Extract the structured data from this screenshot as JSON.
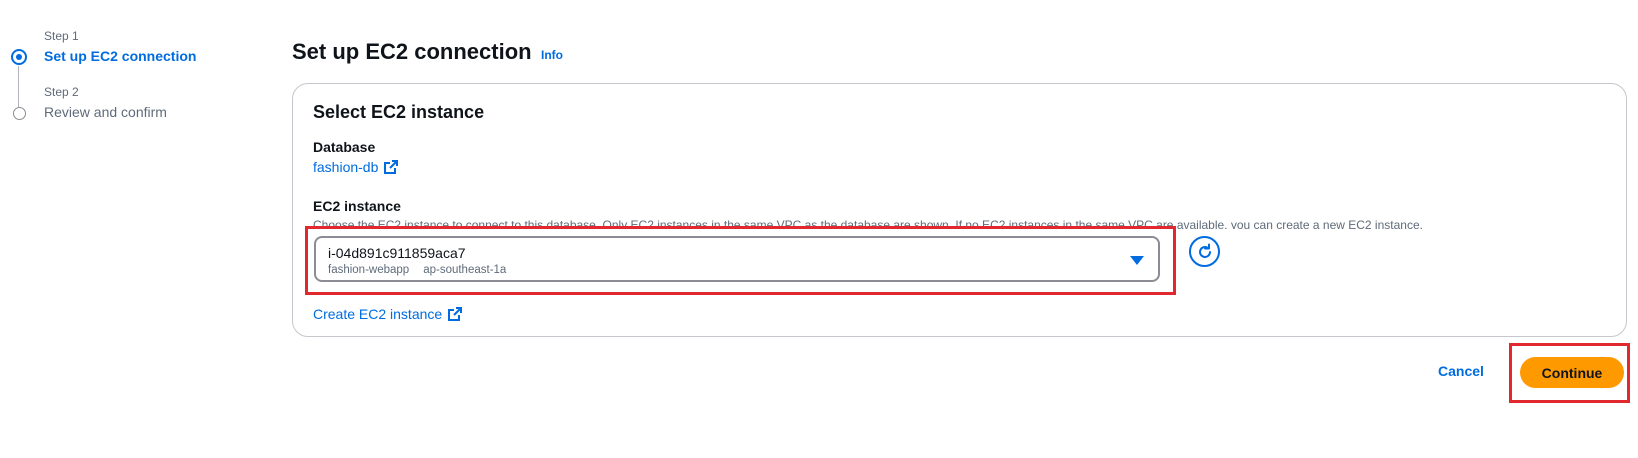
{
  "steps": [
    {
      "number": "Step 1",
      "title": "Set up EC2 connection",
      "state": "active"
    },
    {
      "number": "Step 2",
      "title": "Review and confirm",
      "state": "inactive"
    }
  ],
  "header": {
    "title": "Set up EC2 connection",
    "info_link": "Info"
  },
  "panel": {
    "title": "Select EC2 instance",
    "database": {
      "label": "Database",
      "value": "fashion-db",
      "icon": "external-link-icon"
    },
    "ec2": {
      "label": "EC2 instance",
      "description": "Choose the EC2 instance to connect to this database. Only EC2 instances in the same VPC as the database are shown. If no EC2 instances in the same VPC are available, you can create a new EC2 instance.",
      "selected_value": "i-04d891c911859aca7",
      "tags": [
        "fashion-webapp",
        "ap-southeast-1a"
      ],
      "refresh_icon": "refresh-icon",
      "create_link": "Create EC2 instance"
    }
  },
  "actions": {
    "cancel_label": "Cancel",
    "continue_label": "Continue"
  },
  "colors": {
    "accent": "#006ce0",
    "primary_button": "#ff9900",
    "highlight": "#e0282e"
  }
}
